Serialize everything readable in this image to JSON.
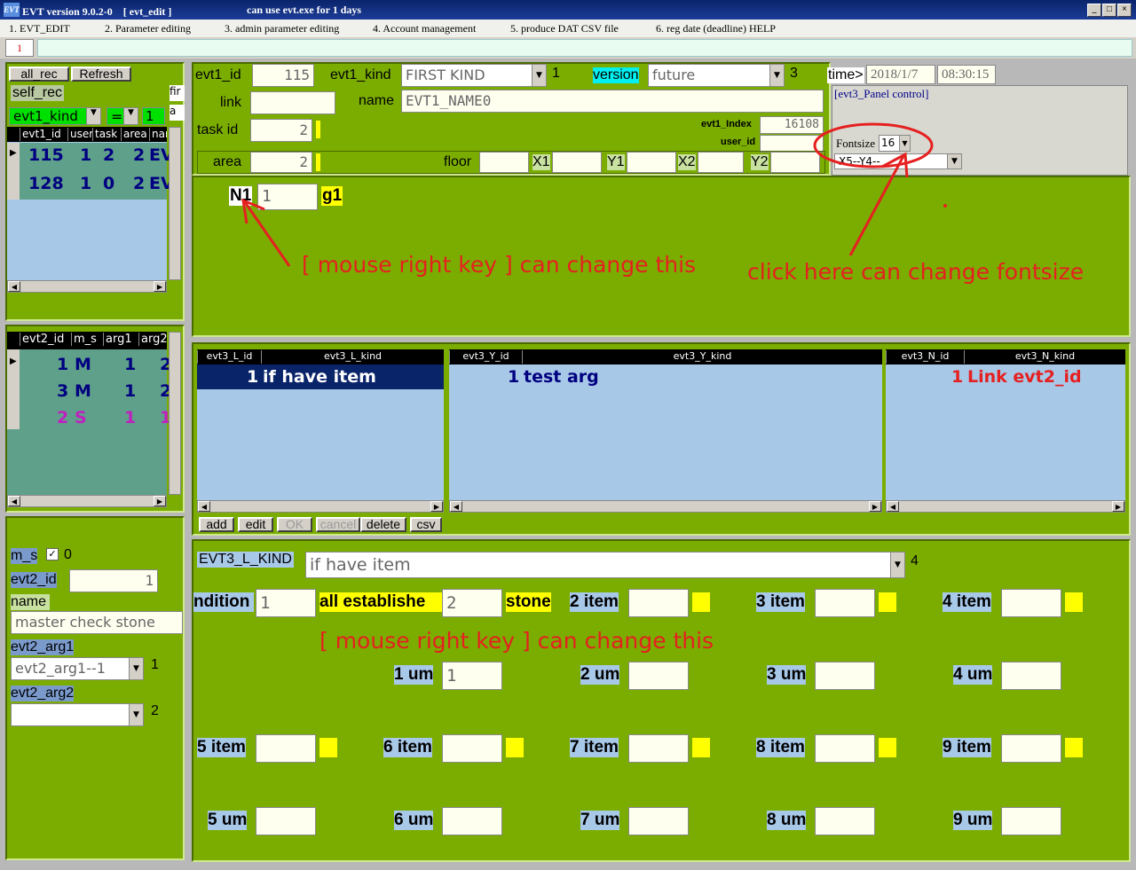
{
  "window": {
    "title": "EVT version 9.0.2-0　[ evt_edit ]",
    "message": "can use evt.exe for 1 days",
    "logo": "EVT",
    "min": "_",
    "max": "□",
    "close": "×"
  },
  "menu": [
    "1.  EVT_EDIT",
    "2.  Parameter editing",
    "3.  admin parameter editing",
    "4.  Account management",
    "5.  produce DAT CSV file",
    "6.  reg date  (deadline) HELP"
  ],
  "toolbar_value": "1",
  "left1": {
    "all_rec": "all_rec",
    "refresh": "Refresh",
    "self_rec": "self_rec",
    "kind_label": "evt1_kind",
    "op": "=",
    "kind_value": "1",
    "fir": "fir",
    "a": "a",
    "columns": [
      "evt1_id",
      "user",
      "task",
      "area",
      "nam"
    ],
    "rows": [
      [
        "115",
        "1",
        "2",
        "2",
        "EV"
      ],
      [
        "128",
        "1",
        "0",
        "2",
        "EV"
      ]
    ]
  },
  "left2": {
    "columns": [
      "evt2_id",
      "m_s",
      "arg1",
      "arg2"
    ],
    "rows": [
      [
        "1",
        "M",
        "1",
        "2"
      ],
      [
        "3",
        "M",
        "1",
        "2"
      ],
      [
        "2",
        "S",
        "1",
        "1"
      ]
    ]
  },
  "left3": {
    "m_s_label": "m_s",
    "m_s_value": "0",
    "evt2_id_label": "evt2_id",
    "evt2_id_value": "1",
    "name_label": "name",
    "name_value": "master check stone",
    "arg1_label": "evt2_arg1",
    "arg1_value": "evt2_arg1--1",
    "arg1_num": "1",
    "arg2_label": "evt2_arg2",
    "arg2_value": "",
    "arg2_num": "2"
  },
  "top": {
    "evt1_id_label": "evt1_id",
    "evt1_id": "115",
    "evt1_kind_label": "evt1_kind",
    "evt1_kind": "FIRST KIND",
    "kind_num": "1",
    "version_label": "version",
    "version": "future",
    "version_num": "3",
    "time_label": "time>",
    "date": "2018/1/7",
    "time": "08:30:15",
    "link_label": "link",
    "link": "",
    "name_label": "name",
    "name": "EVT1_NAME0",
    "task_label": "task id",
    "task": "2",
    "index_label": "evt1_Index",
    "index": "16108",
    "user_label": "user_id",
    "user": "",
    "area_label": "area",
    "area": "2",
    "floor_label": "floor",
    "floor": "",
    "x1_label": "X1",
    "x1": "",
    "y1_label": "Y1",
    "y1": "",
    "x2_label": "X2",
    "x2": "",
    "y2_label": "Y2",
    "y2": "",
    "panel_title": "[evt3_Panel control]",
    "fontsize_label": "Fontsize",
    "fontsize": "16",
    "xy_combo": "X5--Y4--"
  },
  "n1": {
    "label": "N1",
    "value": "1",
    "g1": "g1"
  },
  "annot": {
    "a1": "[ mouse right  key ] can change  this",
    "a2": "click here can  change  fontsize",
    "a3": "[ mouse right  key ] can change  this"
  },
  "lists": {
    "l": {
      "headers": [
        "evt3_L_id",
        "evt3_L_kind"
      ],
      "rows": [
        [
          "1",
          "if have item"
        ]
      ]
    },
    "y": {
      "headers": [
        "evt3_Y_id",
        "evt3_Y_kind"
      ],
      "rows": [
        [
          "1",
          "test arg"
        ]
      ]
    },
    "n": {
      "headers": [
        "evt3_N_id",
        "evt3_N_kind"
      ],
      "rows": [
        [
          "1",
          "Link evt2_id"
        ]
      ]
    },
    "buttons": [
      "add",
      "edit",
      "OK",
      "cancel",
      "delete",
      "csv"
    ]
  },
  "bottom": {
    "kind_label": "EVT3_L_KIND",
    "kind_value": "if have item",
    "kind_num": "4",
    "cond_label": "ndition",
    "cond_value": "1",
    "all_label": "all establishe",
    "all_value": "2",
    "stone": "stone",
    "items": [
      "2 item",
      "3 item",
      "4 item"
    ],
    "ums": [
      "1 um",
      "2 um",
      "3 um",
      "4 um"
    ],
    "um1_value": "1",
    "items2": [
      "5 item",
      "6 item",
      "7 item",
      "8 item",
      "9 item"
    ],
    "ums2": [
      "5 um",
      "6 um",
      "7 um",
      "8 um",
      "9 um"
    ]
  },
  "colors": {
    "panel": "#7bad00",
    "annotation": "#e52020",
    "grid": "#5fa08a",
    "list": "#a8c8e8"
  }
}
